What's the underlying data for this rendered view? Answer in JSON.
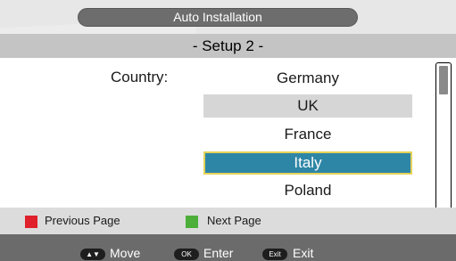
{
  "header": {
    "title": "Auto Installation",
    "subtitle": "- Setup 2 -"
  },
  "setup": {
    "country_label": "Country:",
    "countries": [
      {
        "name": "Germany",
        "state": "normal"
      },
      {
        "name": "UK",
        "state": "shaded"
      },
      {
        "name": "France",
        "state": "normal"
      },
      {
        "name": "Italy",
        "state": "selected"
      },
      {
        "name": "Poland",
        "state": "normal"
      }
    ],
    "selected_country": "Italy"
  },
  "color_keys": {
    "previous": {
      "label": "Previous Page",
      "color": "#e0202a"
    },
    "next": {
      "label": "Next Page",
      "color": "#4caf3a"
    }
  },
  "nav": {
    "move": {
      "key": "▲▼",
      "label": "Move"
    },
    "enter": {
      "key": "OK",
      "label": "Enter"
    },
    "exit": {
      "key": "Exit",
      "label": "Exit"
    }
  },
  "colors": {
    "selected_bg": "#2e86a6",
    "selected_border": "#e6d35a",
    "title_pill": "#6d6d6d"
  }
}
